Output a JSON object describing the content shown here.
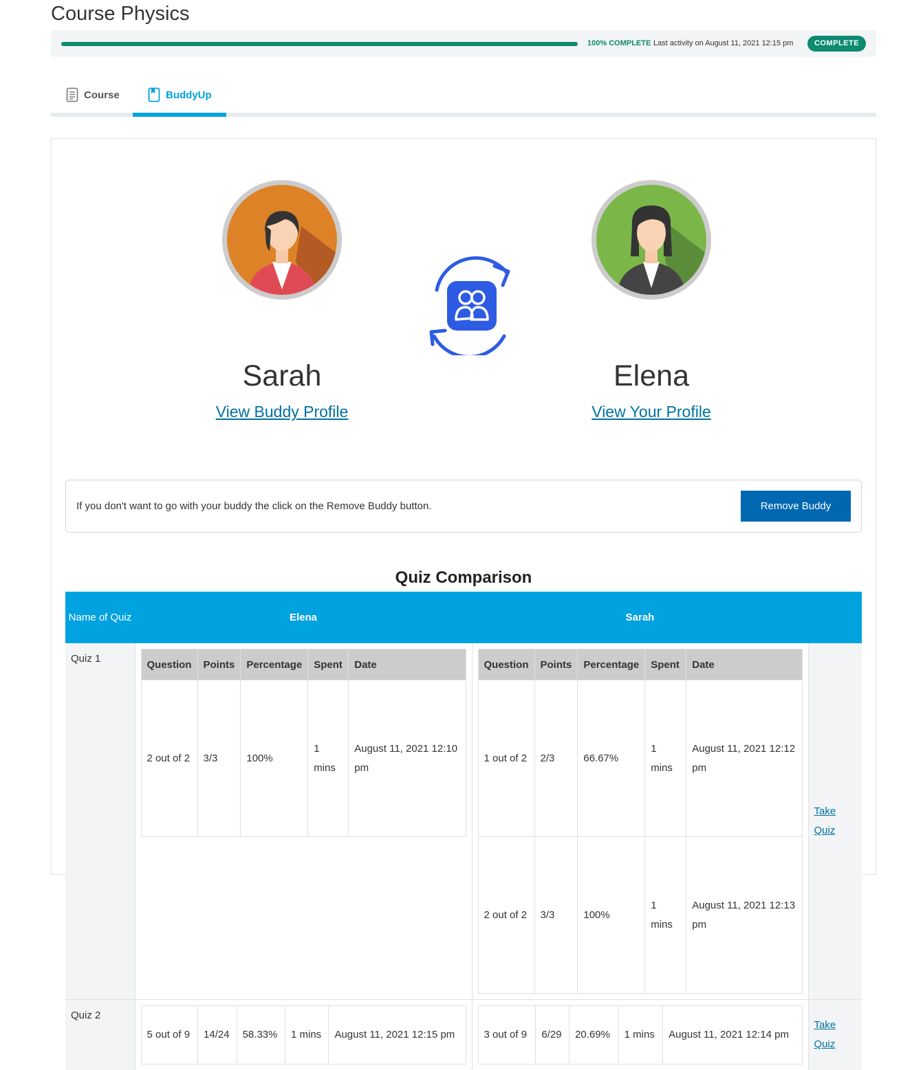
{
  "course": {
    "title": "Course Physics",
    "progress_percent": 100,
    "progress_label": "100% COMPLETE",
    "last_activity": "Last activity on August 11, 2021 12:15 pm",
    "status_badge": "COMPLETE"
  },
  "tabs": [
    {
      "label": "Course",
      "icon": "document-icon",
      "active": false
    },
    {
      "label": "BuddyUp",
      "icon": "bookmark-icon",
      "active": true
    }
  ],
  "buddy": {
    "name": "Sarah",
    "link": "View Buddy Profile"
  },
  "me": {
    "name": "Elena",
    "link": "View Your Profile"
  },
  "notice": {
    "text": "If you don't want to go with your buddy the click on the Remove Buddy button.",
    "button": "Remove Buddy"
  },
  "quiz_comparison": {
    "title": "Quiz Comparison",
    "headers": {
      "name_of_quiz": "Name of Quiz",
      "col_a": "Elena",
      "col_b": "Sarah"
    },
    "inner_headers": [
      "Question",
      "Points",
      "Percentage",
      "Spent",
      "Date"
    ],
    "action_label": "Take Quiz",
    "rows": [
      {
        "name": "Quiz 1",
        "elena": [
          [
            "2 out of 2",
            "3/3",
            "100%",
            "1 mins",
            "August 11, 2021 12:10 pm"
          ]
        ],
        "sarah": [
          [
            "1 out of 2",
            "2/3",
            "66.67%",
            "1 mins",
            "August 11, 2021 12:12 pm"
          ],
          [
            "2 out of 2",
            "3/3",
            "100%",
            "1 mins",
            "August 11, 2021 12:13 pm"
          ]
        ]
      },
      {
        "name": "Quiz 2",
        "elena": [
          [
            "5 out of 9",
            "14/24",
            "58.33%",
            "1 mins",
            "August 11, 2021 12:15 pm"
          ]
        ],
        "sarah": [
          [
            "3 out of 9",
            "6/29",
            "20.69%",
            "1 mins",
            "August 11, 2021 12:14 pm"
          ]
        ]
      }
    ]
  },
  "colors": {
    "accent": "#00a2e0",
    "progress": "#0d8a6f",
    "button": "#0067b1",
    "link": "#0071a1"
  }
}
